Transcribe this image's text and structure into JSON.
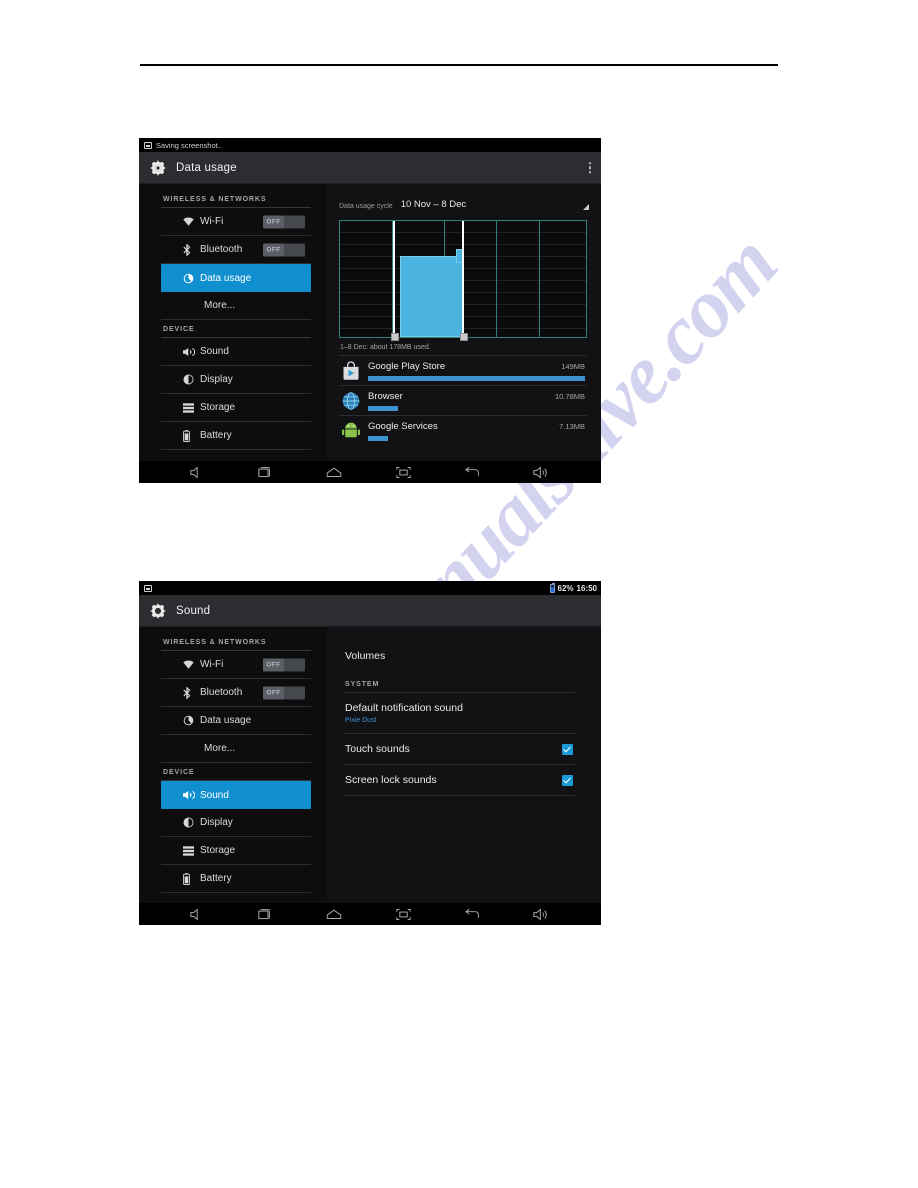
{
  "watermark": {
    "text": "manualshive.com"
  },
  "screenshot_1": {
    "status_bar": {
      "icon": "screenshot-icon",
      "message": "Saving screenshot.."
    },
    "action_bar": {
      "icon": "settings-gear-icon",
      "title": "Data usage",
      "overflow": "overflow-menu-icon"
    },
    "sidebar": {
      "groups": [
        {
          "header": "WIRELESS & NETWORKS",
          "items": [
            {
              "icon": "wifi-icon",
              "label": "Wi-Fi",
              "toggle": "OFF",
              "selected": false
            },
            {
              "icon": "bluetooth-icon",
              "label": "Bluetooth",
              "toggle": "OFF",
              "selected": false
            },
            {
              "icon": "data-usage-icon",
              "label": "Data usage",
              "toggle": null,
              "selected": true
            },
            {
              "icon": null,
              "label": "More...",
              "toggle": null,
              "selected": false
            }
          ]
        },
        {
          "header": "DEVICE",
          "items": [
            {
              "icon": "sound-icon",
              "label": "Sound",
              "toggle": null,
              "selected": false
            },
            {
              "icon": "display-icon",
              "label": "Display",
              "toggle": null,
              "selected": false
            },
            {
              "icon": "storage-icon",
              "label": "Storage",
              "toggle": null,
              "selected": false
            },
            {
              "icon": "battery-icon",
              "label": "Battery",
              "toggle": null,
              "selected": false
            }
          ]
        }
      ]
    },
    "cycle": {
      "label": "Data usage cycle",
      "value": "10 Nov – 8 Dec"
    },
    "used_note": "1–8 Dec: about 178MB used.",
    "apps": [
      {
        "icon": "google-play-store-icon",
        "name": "Google Play Store",
        "size": "149MB",
        "bar_pct": 100
      },
      {
        "icon": "browser-icon",
        "name": "Browser",
        "size": "10.78MB",
        "bar_pct": 14
      },
      {
        "icon": "google-services-icon",
        "name": "Google Services",
        "size": "7.13MB",
        "bar_pct": 9
      }
    ],
    "nav_bar": [
      "volume-down-icon",
      "recent-apps-icon",
      "home-icon",
      "screenshot-capture-icon",
      "back-icon",
      "volume-up-icon"
    ]
  },
  "screenshot_2": {
    "status_bar": {
      "icon": "screenshot-icon",
      "battery": "62%",
      "time": "16:50"
    },
    "action_bar": {
      "icon": "settings-gear-icon",
      "title": "Sound"
    },
    "sidebar": {
      "groups": [
        {
          "header": "WIRELESS & NETWORKS",
          "items": [
            {
              "icon": "wifi-icon",
              "label": "Wi-Fi",
              "toggle": "OFF",
              "selected": false
            },
            {
              "icon": "bluetooth-icon",
              "label": "Bluetooth",
              "toggle": "OFF",
              "selected": false
            },
            {
              "icon": "data-usage-icon",
              "label": "Data usage",
              "toggle": null,
              "selected": false
            },
            {
              "icon": null,
              "label": "More...",
              "toggle": null,
              "selected": false
            }
          ]
        },
        {
          "header": "DEVICE",
          "items": [
            {
              "icon": "sound-icon",
              "label": "Sound",
              "toggle": null,
              "selected": true
            },
            {
              "icon": "display-icon",
              "label": "Display",
              "toggle": null,
              "selected": false
            },
            {
              "icon": "storage-icon",
              "label": "Storage",
              "toggle": null,
              "selected": false
            },
            {
              "icon": "battery-icon",
              "label": "Battery",
              "toggle": null,
              "selected": false
            }
          ]
        }
      ]
    },
    "pane": {
      "volumes": "Volumes",
      "system_group": "SYSTEM",
      "default_notification": {
        "title": "Default notification sound",
        "sub": "Pixie Dust"
      },
      "touch_sounds": {
        "title": "Touch sounds",
        "checked": true
      },
      "screen_lock_sounds": {
        "title": "Screen lock sounds",
        "checked": true
      }
    },
    "nav_bar": [
      "volume-down-icon",
      "recent-apps-icon",
      "home-icon",
      "screenshot-capture-icon",
      "back-icon",
      "volume-up-icon"
    ]
  },
  "colors": {
    "accent_blue": "#0f8fce",
    "chart_fill": "#4ab3e0",
    "chart_grid": "#2f7f7a",
    "app_bar": "#3d93d0",
    "checkbox": "#1b9bd6",
    "link_blue": "#3f8fd0",
    "action_bar_bg": "#2b2d31",
    "watermark": "#3b3bbd"
  }
}
